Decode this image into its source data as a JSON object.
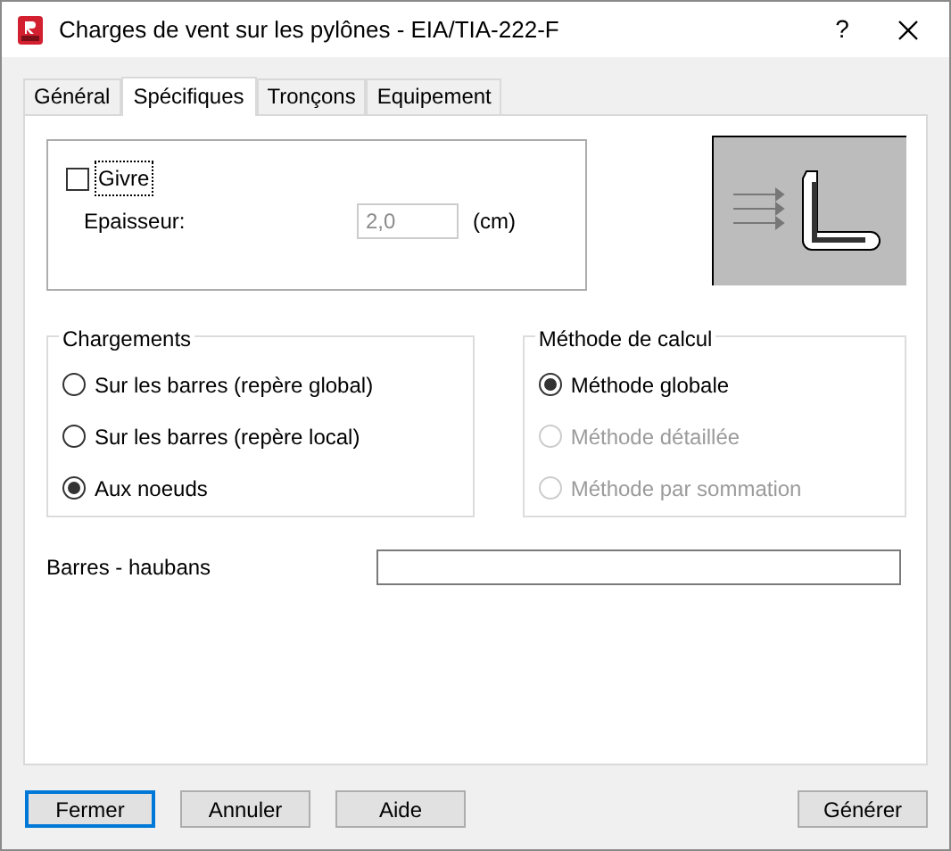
{
  "window": {
    "title": "Charges de vent sur les pylônes - EIA/TIA-222-F",
    "help": "?"
  },
  "tabs": [
    {
      "label": "Général",
      "selected": false
    },
    {
      "label": "Spécifiques",
      "selected": true
    },
    {
      "label": "Tronçons",
      "selected": false
    },
    {
      "label": "Equipement",
      "selected": false
    }
  ],
  "ice": {
    "label": "Givre",
    "checked": false,
    "thickness": {
      "label": "Epaisseur:",
      "value": "2,0",
      "disabled": true,
      "unit": "(cm)"
    }
  },
  "loads": {
    "title": "Chargements",
    "options": [
      {
        "label": "Sur les barres (repère global)",
        "selected": false,
        "disabled": false
      },
      {
        "label": "Sur les barres (repère local)",
        "selected": false,
        "disabled": false
      },
      {
        "label": "Aux noeuds",
        "selected": true,
        "disabled": false
      }
    ]
  },
  "method": {
    "title": "Méthode de calcul",
    "options": [
      {
        "label": "Méthode globale",
        "selected": true,
        "disabled": false
      },
      {
        "label": "Méthode détaillée",
        "selected": false,
        "disabled": true
      },
      {
        "label": "Méthode par sommation",
        "selected": false,
        "disabled": true
      }
    ]
  },
  "guys": {
    "label": "Barres - haubans"
  },
  "buttons": [
    {
      "label": "Fermer",
      "default": true
    },
    {
      "label": "Annuler",
      "default": false
    },
    {
      "label": "Aide",
      "default": false
    },
    {
      "label": "Générer",
      "default": false
    }
  ]
}
